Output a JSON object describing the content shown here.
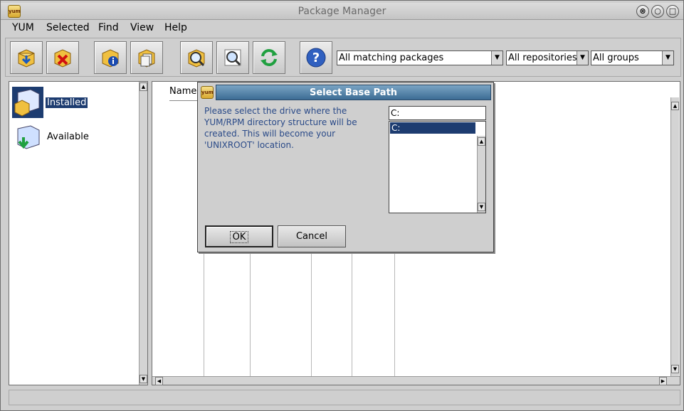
{
  "window": {
    "title": "Package Manager",
    "logo_text": "yum",
    "controls": {
      "close": "⊗",
      "minimize": "○",
      "maximize": "□"
    }
  },
  "menu": [
    {
      "label": "YUM"
    },
    {
      "label": "Selected"
    },
    {
      "label": "Find"
    },
    {
      "label": "View"
    },
    {
      "label": "Help"
    }
  ],
  "toolbar": {
    "buttons": [
      {
        "icon": "package-install-icon"
      },
      {
        "icon": "package-remove-icon"
      },
      {
        "icon": "package-info-icon"
      },
      {
        "icon": "package-files-icon"
      },
      {
        "icon": "package-search-icon"
      },
      {
        "icon": "find-icon"
      },
      {
        "icon": "refresh-icon"
      },
      {
        "icon": "help-icon"
      }
    ],
    "filters": {
      "packages": "All matching packages",
      "repositories": "All repositories",
      "groups": "All groups"
    }
  },
  "sidebar": {
    "items": [
      {
        "label": "Installed",
        "selected": true
      },
      {
        "label": "Available",
        "selected": false
      }
    ]
  },
  "package_list": {
    "columns": [
      "Name"
    ]
  },
  "dialog": {
    "logo_text": "yum",
    "title": "Select Base Path",
    "message": "Please select the drive where the YUM/RPM directory structure will be created. This will become your 'UNIXROOT' location.",
    "path_value": "C:",
    "drives": [
      "C:"
    ],
    "ok_label": "OK",
    "cancel_label": "Cancel"
  }
}
